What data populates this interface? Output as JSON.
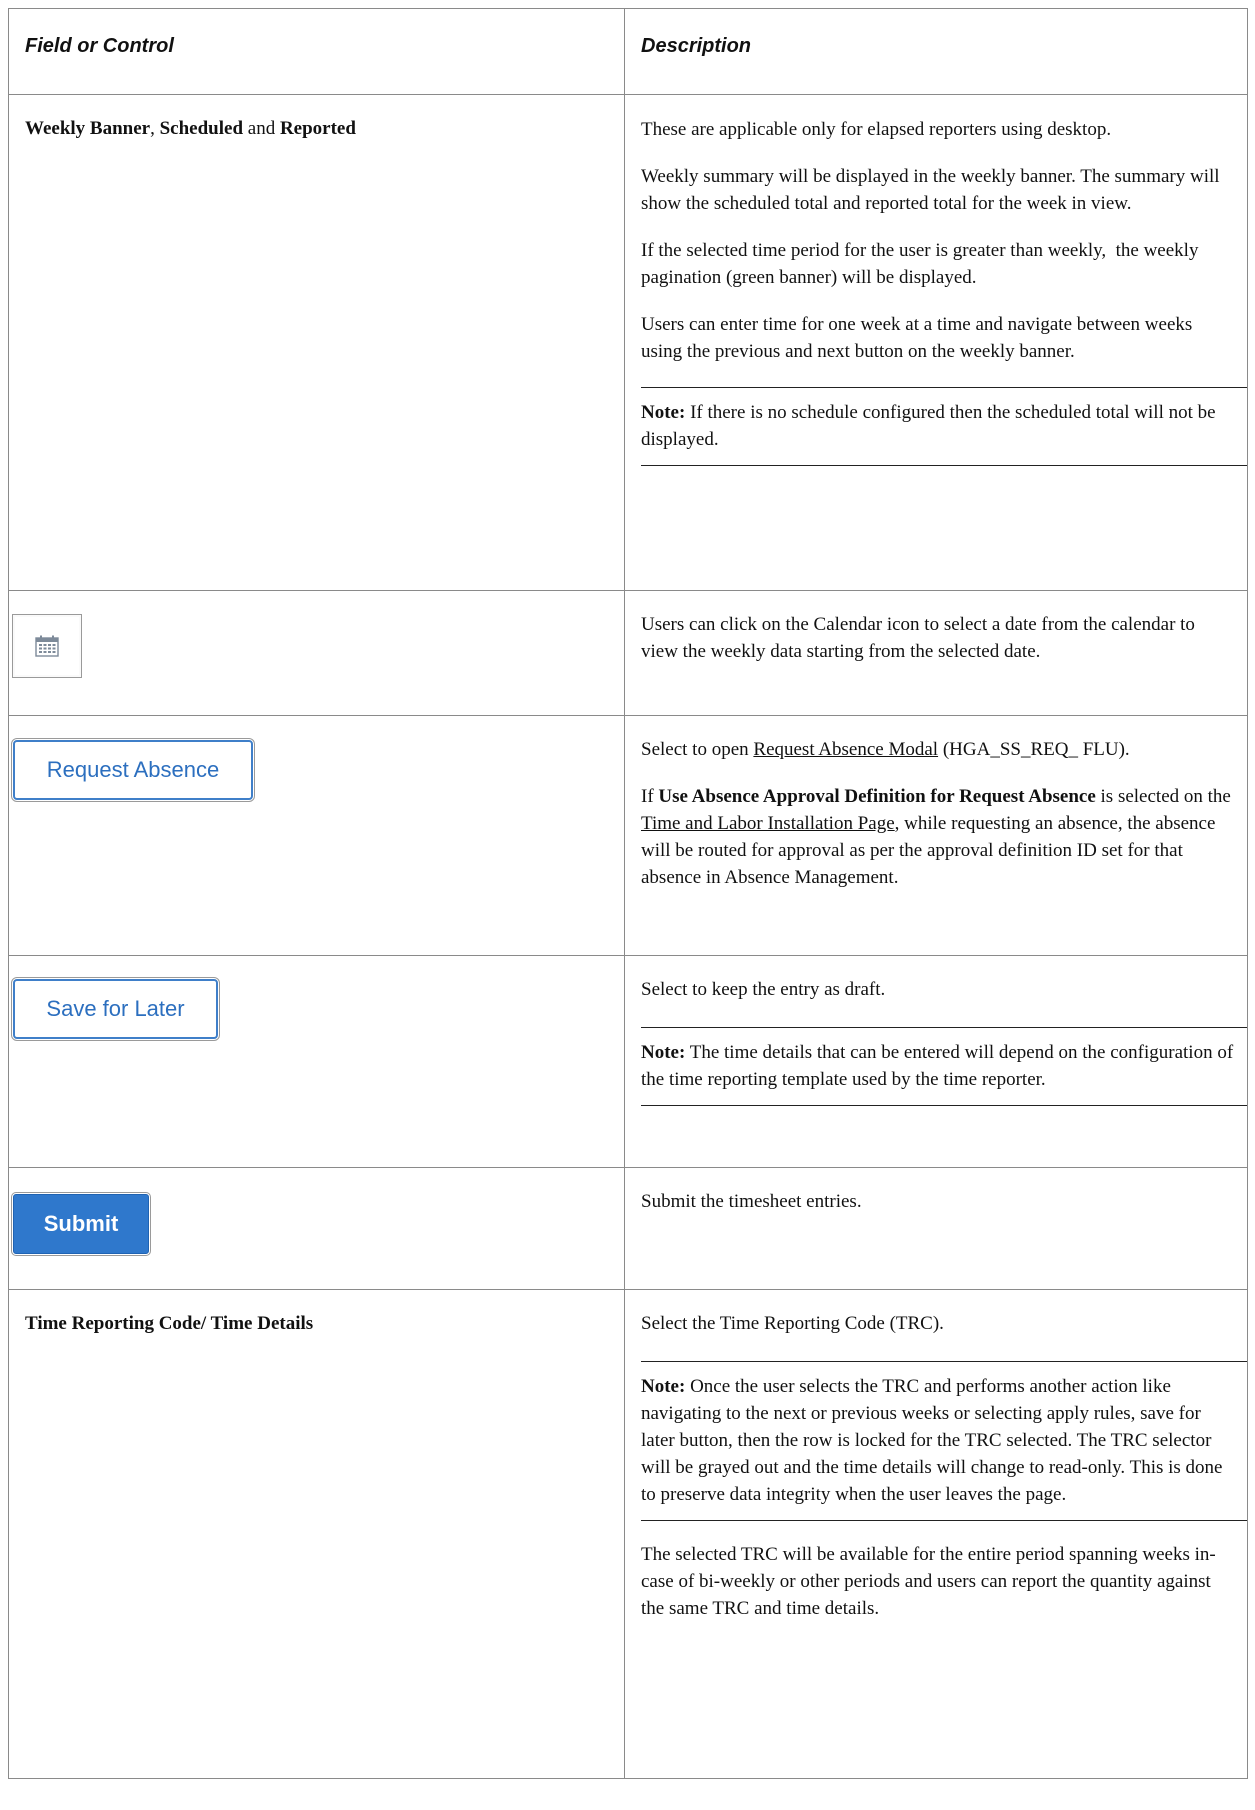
{
  "header": {
    "col1": "Field or Control",
    "col2": "Description"
  },
  "row_weekly": {
    "label_part1": "Weekly Banner",
    "label_sep1": ", ",
    "label_part2": "Scheduled",
    "label_sep2": " and ",
    "label_part3": "Reported",
    "p1": "These are applicable only for elapsed reporters using desktop.",
    "p2": "Weekly summary will be displayed in the weekly banner. The summary will show the scheduled total and reported total for the week in view.",
    "p3": "If the selected time period for the user is greater than weekly,  the weekly pagination (green banner) will be displayed.",
    "p4": "Users can enter time for one week at a time and navigate between weeks using the previous and next button on the weekly banner.",
    "note_label": "Note:",
    "note_text": " If there is no schedule configured then the scheduled total will not be displayed."
  },
  "row_calendar": {
    "icon": "calendar-icon",
    "p1": "Users can click on the Calendar icon to select a date from the calendar to view the weekly data starting from the selected date."
  },
  "row_request": {
    "button_label": "Request Absence",
    "p1_pre": "Select to open ",
    "p1_link": "Request Absence Modal",
    "p1_post": " (HGA_SS_REQ_ FLU).",
    "p2_pre": "If ",
    "p2_bold": "Use Absence Approval Definition for Request Absence",
    "p2_mid": " is selected on the ",
    "p2_link": "Time and Labor Installation Page",
    "p2_post": ", while requesting an absence, the absence will be routed for approval as per the approval definition ID set for that absence in Absence Management."
  },
  "row_save": {
    "button_label": "Save for Later",
    "p1": "Select to keep the entry as draft.",
    "note_label": "Note:",
    "note_text": " The time details that can be entered will depend on the configuration of the time reporting template used by the time reporter."
  },
  "row_submit": {
    "button_label": "Submit",
    "p1": "Submit the timesheet entries."
  },
  "row_trc": {
    "label": "Time Reporting Code/ Time Details",
    "p1": "Select the Time Reporting Code (TRC).",
    "note_label": "Note:",
    "note_text": " Once the user selects the TRC and performs another action like navigating to the next or previous weeks or selecting apply rules, save for later button, then the row is locked for the TRC selected. The TRC selector will be grayed out and the time details will change to read-only. This is done to preserve data integrity when the user leaves the page.",
    "p2": "The selected TRC will be available for the entire period spanning weeks in-case of bi-weekly or other periods and users can report the quantity against the same TRC and time details."
  },
  "colors": {
    "link_button_blue": "#2c6fbf",
    "submit_blue": "#2f78cc",
    "border_gray": "#8a8a8a"
  }
}
